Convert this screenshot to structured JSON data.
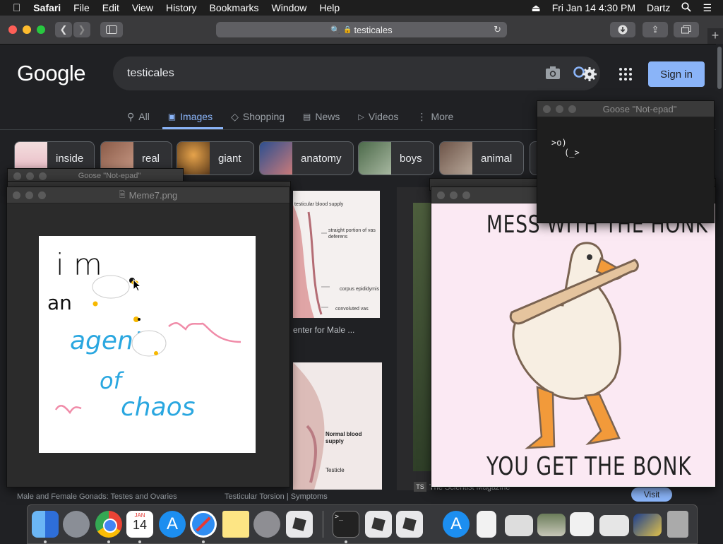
{
  "menubar": {
    "app": "Safari",
    "items": [
      "File",
      "Edit",
      "View",
      "History",
      "Bookmarks",
      "Window",
      "Help"
    ],
    "datetime": "Fri Jan 14  4:30 PM",
    "user": "Dartz"
  },
  "browser": {
    "url": "testicales"
  },
  "google": {
    "logo": "Google",
    "query": "testicales",
    "sign_in": "Sign in",
    "tabs": [
      "All",
      "Images",
      "Shopping",
      "News",
      "Videos",
      "More"
    ],
    "chips": [
      "inside",
      "real",
      "giant",
      "anatomy",
      "boys",
      "animal"
    ]
  },
  "results": {
    "caption1": "enter for Male ...",
    "caption_bottom1": "Male and Female Gonads: Testes and Ovaries",
    "caption_bottom2": "Testicular Torsion | Symptoms",
    "source_badge": "TS",
    "source_name": "The Scientist Magazine",
    "visit": "Visit",
    "diagram1": {
      "l1": "testicular blood supply",
      "l2": "straight portion of vas deferens",
      "l3": "corpus epididymis",
      "l4": "convoluted vas"
    },
    "diagram2": {
      "l1": "Normal blood supply",
      "l2": "Testicle"
    }
  },
  "notepad_back": {
    "title": "Goose \"Not-epad\""
  },
  "meme7": {
    "title": "Meme7.png",
    "text": [
      "i m",
      "an",
      "agent",
      "of",
      "chaos"
    ]
  },
  "notepad": {
    "title": "Goose \"Not-epad\"",
    "line1": ">o)",
    "line2": "(_>"
  },
  "goose_meme": {
    "top": "MESS WITH THE HONK",
    "bottom": "YOU GET THE BONK"
  },
  "dock": {
    "calendar_month": "JAN",
    "calendar_day": "14"
  }
}
